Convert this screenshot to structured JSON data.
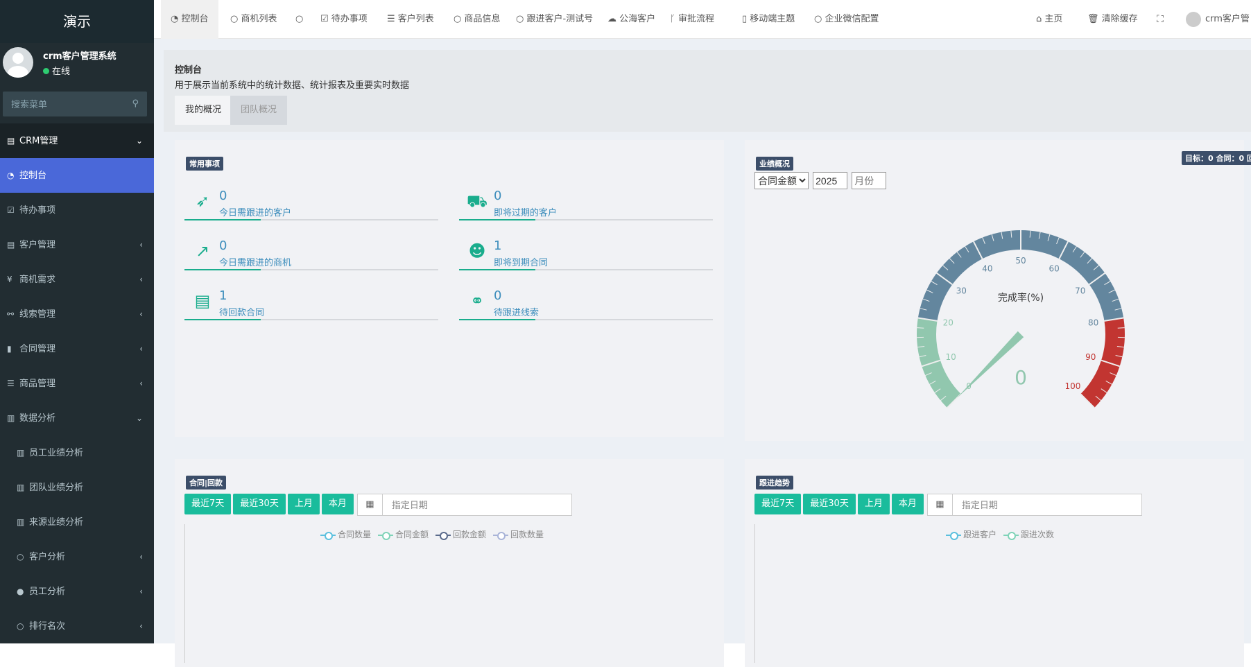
{
  "app": {
    "logo": "演示"
  },
  "user": {
    "name": "crm客户管理系统",
    "status": "在线"
  },
  "sidebar_search": {
    "placeholder": "搜索菜单"
  },
  "sidebar": {
    "items": [
      {
        "label": "CRM管理",
        "icon": "id-card-icon",
        "arrow": "⌄",
        "state": "head"
      },
      {
        "label": "控制台",
        "icon": "dashboard-icon",
        "arrow": "",
        "state": "active"
      },
      {
        "label": "待办事项",
        "icon": "calendar-check-icon",
        "arrow": "",
        "state": ""
      },
      {
        "label": "客户管理",
        "icon": "id-card-icon",
        "arrow": "‹",
        "state": ""
      },
      {
        "label": "商机需求",
        "icon": "yen-icon",
        "arrow": "‹",
        "state": ""
      },
      {
        "label": "线索管理",
        "icon": "link-icon",
        "arrow": "‹",
        "state": ""
      },
      {
        "label": "合同管理",
        "icon": "bookmark-icon",
        "arrow": "‹",
        "state": ""
      },
      {
        "label": "商品管理",
        "icon": "list-icon",
        "arrow": "‹",
        "state": ""
      },
      {
        "label": "数据分析",
        "icon": "bar-chart-icon",
        "arrow": "⌄",
        "state": ""
      },
      {
        "label": "员工业绩分析",
        "icon": "bar-chart-icon",
        "arrow": "",
        "state": "sub"
      },
      {
        "label": "团队业绩分析",
        "icon": "bar-chart-icon",
        "arrow": "",
        "state": "sub"
      },
      {
        "label": "来源业绩分析",
        "icon": "bar-chart-icon",
        "arrow": "",
        "state": "sub"
      },
      {
        "label": "客户分析",
        "icon": "circle-icon",
        "arrow": "‹",
        "state": "sub"
      },
      {
        "label": "员工分析",
        "icon": "user-icon",
        "arrow": "‹",
        "state": "sub"
      },
      {
        "label": "排行名次",
        "icon": "circle-icon",
        "arrow": "‹",
        "state": "sub"
      }
    ]
  },
  "topbar": {
    "tabs": [
      {
        "label": "控制台",
        "icon": "dashboard-icon"
      },
      {
        "label": "商机列表",
        "icon": "circle-icon"
      },
      {
        "label": "",
        "icon": "circle-icon"
      },
      {
        "label": "待办事项",
        "icon": "calendar-check-icon"
      },
      {
        "label": "客户列表",
        "icon": "list-icon"
      },
      {
        "label": "商品信息",
        "icon": "circle-icon"
      },
      {
        "label": "跟进客户-测试号",
        "icon": "circle-icon"
      },
      {
        "label": "公海客户",
        "icon": "cloud-icon"
      },
      {
        "label": "审批流程",
        "icon": "branch-icon"
      },
      {
        "label": "移动端主题",
        "icon": "mobile-icon"
      },
      {
        "label": "企业微信配置",
        "icon": "circle-icon"
      }
    ],
    "home": "主页",
    "clear_cache": "清除缓存",
    "user": "crm客户管"
  },
  "page": {
    "title": "控制台",
    "subtitle": "用于展示当前系统中的统计数据、统计报表及重要实时数据",
    "tabs": [
      "我的概况",
      "团队概况"
    ]
  },
  "common": {
    "label": "常用事项",
    "items": [
      {
        "count": "0",
        "text": "今日需跟进的客户",
        "icon": "rocket-icon"
      },
      {
        "count": "0",
        "text": "即将过期的客户",
        "icon": "cart-icon"
      },
      {
        "count": "0",
        "text": "今日需跟进的商机",
        "icon": "line-chart-icon"
      },
      {
        "count": "1",
        "text": "即将到期合同",
        "icon": "users-icon"
      },
      {
        "count": "1",
        "text": "待回款合同",
        "icon": "list-alt-icon"
      },
      {
        "count": "0",
        "text": "待跟进线索",
        "icon": "chain-icon"
      }
    ]
  },
  "performance": {
    "label": "业绩概况",
    "target": "目标：0   合同：0   回",
    "metric": "合同金额",
    "year": "2025",
    "month_placeholder": "月份"
  },
  "chart_data": {
    "type": "gauge",
    "title": "完成率(%)",
    "value": 0,
    "min": 0,
    "max": 100,
    "ticks": [
      "0",
      "10",
      "20",
      "30",
      "40",
      "50",
      "60",
      "70",
      "80",
      "90",
      "100"
    ],
    "bands": [
      {
        "to": 20,
        "color": "#91c7ae"
      },
      {
        "to": 80,
        "color": "#63869e"
      },
      {
        "to": 100,
        "color": "#c23531"
      }
    ]
  },
  "contract": {
    "label": "合同|回款",
    "buttons": [
      "最近7天",
      "最近30天",
      "上月",
      "本月"
    ],
    "date_placeholder": "指定日期",
    "legend": [
      {
        "name": "合同数量",
        "color": "#5bc0de"
      },
      {
        "name": "合同金额",
        "color": "#7fd3b8"
      },
      {
        "name": "回款金额",
        "color": "#5a6b8c"
      },
      {
        "name": "回款数量",
        "color": "#a9b4d8"
      }
    ]
  },
  "followup": {
    "label": "跟进趋势",
    "buttons": [
      "最近7天",
      "最近30天",
      "上月",
      "本月"
    ],
    "date_placeholder": "指定日期",
    "legend": [
      {
        "name": "跟进客户",
        "color": "#5bc0de"
      },
      {
        "name": "跟进次数",
        "color": "#7fd3b8"
      }
    ]
  }
}
